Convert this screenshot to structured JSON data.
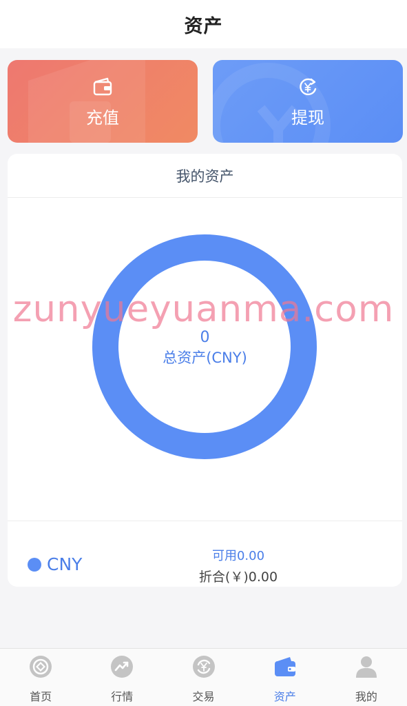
{
  "header": {
    "title": "资产"
  },
  "actions": {
    "deposit_label": "充值",
    "withdraw_label": "提现"
  },
  "asset_panel": {
    "title": "我的资产",
    "total_value": "0",
    "total_label": "总资产(CNY)",
    "currency": "CNY",
    "available": "可用0.00",
    "converted": "折合(￥)0.00"
  },
  "chart_data": {
    "type": "pie",
    "categories": [
      "CNY"
    ],
    "values": [
      0
    ],
    "colors": [
      "#5b8ef5"
    ]
  },
  "watermark": "zunyueyuanma.com",
  "tabs": [
    {
      "label": "首页",
      "icon": "home-icon",
      "active": false
    },
    {
      "label": "行情",
      "icon": "market-icon",
      "active": false
    },
    {
      "label": "交易",
      "icon": "trade-icon",
      "active": false
    },
    {
      "label": "资产",
      "icon": "wallet-icon",
      "active": true
    },
    {
      "label": "我的",
      "icon": "user-icon",
      "active": false
    }
  ],
  "colors": {
    "accent": "#5b8ef5",
    "deposit": "#ef7d6b",
    "tab_inactive_icon": "#c4c4c4"
  }
}
